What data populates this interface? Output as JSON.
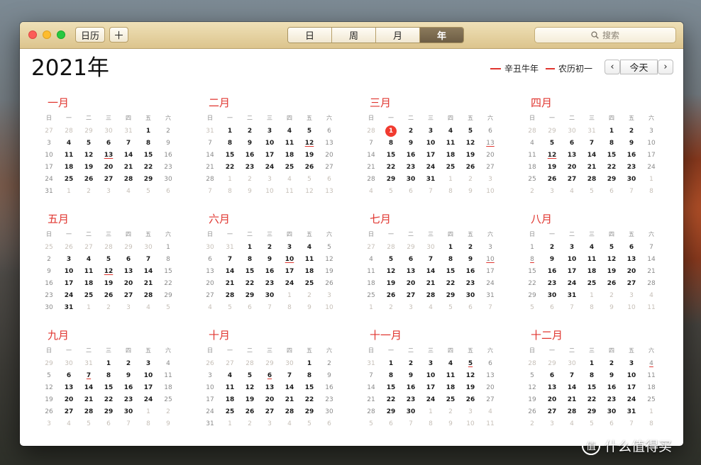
{
  "toolbar": {
    "calendars_label": "日历",
    "add_label": "＋",
    "views": [
      "日",
      "周",
      "月",
      "年"
    ],
    "active_view": "年",
    "search_placeholder": "搜索"
  },
  "header": {
    "year_title": "2021年",
    "legend_1": "辛丑牛年",
    "legend_2": "农历初一",
    "prev_icon": "‹",
    "today_label": "今天",
    "next_icon": "›"
  },
  "colors": {
    "accent": "#e0352f",
    "today": "#f13b30",
    "titlebar": "#dcc48d"
  },
  "weekday_labels": [
    "日",
    "一",
    "二",
    "三",
    "四",
    "五",
    "六"
  ],
  "today": {
    "month": 3,
    "day": 1
  },
  "months": [
    {
      "title": "一月",
      "lead": [
        "27",
        "28",
        "29",
        "30",
        "31"
      ],
      "days": 31,
      "trail": [
        "1",
        "2",
        "3",
        "4",
        "5",
        "6"
      ],
      "holidays": [
        13
      ]
    },
    {
      "title": "二月",
      "lead": [
        "31"
      ],
      "days": 28,
      "trail": [
        "1",
        "2",
        "3",
        "4",
        "5",
        "6",
        "7",
        "8",
        "9",
        "10",
        "11",
        "12",
        "13"
      ],
      "holidays": [
        12
      ]
    },
    {
      "title": "三月",
      "lead": [
        "28"
      ],
      "days": 31,
      "trail": [
        "1",
        "2",
        "3",
        "4",
        "5",
        "6",
        "7",
        "8",
        "9",
        "10"
      ],
      "holidays": [
        13
      ]
    },
    {
      "title": "四月",
      "lead": [
        "28",
        "29",
        "30",
        "31"
      ],
      "days": 30,
      "trail": [
        "1",
        "2",
        "3",
        "4",
        "5",
        "6",
        "7",
        "8"
      ],
      "holidays": [
        12
      ]
    },
    {
      "title": "五月",
      "lead": [
        "25",
        "26",
        "27",
        "28",
        "29",
        "30"
      ],
      "days": 31,
      "trail": [
        "1",
        "2",
        "3",
        "4",
        "5"
      ],
      "holidays": [
        12
      ]
    },
    {
      "title": "六月",
      "lead": [
        "30",
        "31"
      ],
      "days": 30,
      "trail": [
        "1",
        "2",
        "3",
        "4",
        "5",
        "6",
        "7",
        "8",
        "9",
        "10"
      ],
      "holidays": [
        10
      ]
    },
    {
      "title": "七月",
      "lead": [
        "27",
        "28",
        "29",
        "30"
      ],
      "days": 31,
      "trail": [
        "1",
        "2",
        "3",
        "4",
        "5",
        "6",
        "7"
      ],
      "holidays": [
        10
      ]
    },
    {
      "title": "八月",
      "lead": [],
      "days": 31,
      "trail": [
        "1",
        "2",
        "3",
        "4",
        "5",
        "6",
        "7",
        "8",
        "9",
        "10",
        "11"
      ],
      "holidays": [
        8
      ]
    },
    {
      "title": "九月",
      "lead": [
        "29",
        "30",
        "31"
      ],
      "days": 30,
      "trail": [
        "1",
        "2",
        "3",
        "4",
        "5",
        "6",
        "7",
        "8",
        "9"
      ],
      "holidays": [
        7
      ]
    },
    {
      "title": "十月",
      "lead": [
        "26",
        "27",
        "28",
        "29",
        "30"
      ],
      "days": 31,
      "trail": [
        "1",
        "2",
        "3",
        "4",
        "5",
        "6"
      ],
      "holidays": [
        6
      ]
    },
    {
      "title": "十一月",
      "lead": [
        "31"
      ],
      "days": 30,
      "trail": [
        "1",
        "2",
        "3",
        "4",
        "5",
        "6",
        "7",
        "8",
        "9",
        "10",
        "11"
      ],
      "holidays": [
        5
      ]
    },
    {
      "title": "十二月",
      "lead": [
        "28",
        "29",
        "30"
      ],
      "days": 31,
      "trail": [
        "1",
        "2",
        "3",
        "4",
        "5",
        "6",
        "7",
        "8"
      ],
      "holidays": [
        4
      ]
    }
  ],
  "watermark": {
    "logo": "值",
    "text": "什么值得买"
  }
}
